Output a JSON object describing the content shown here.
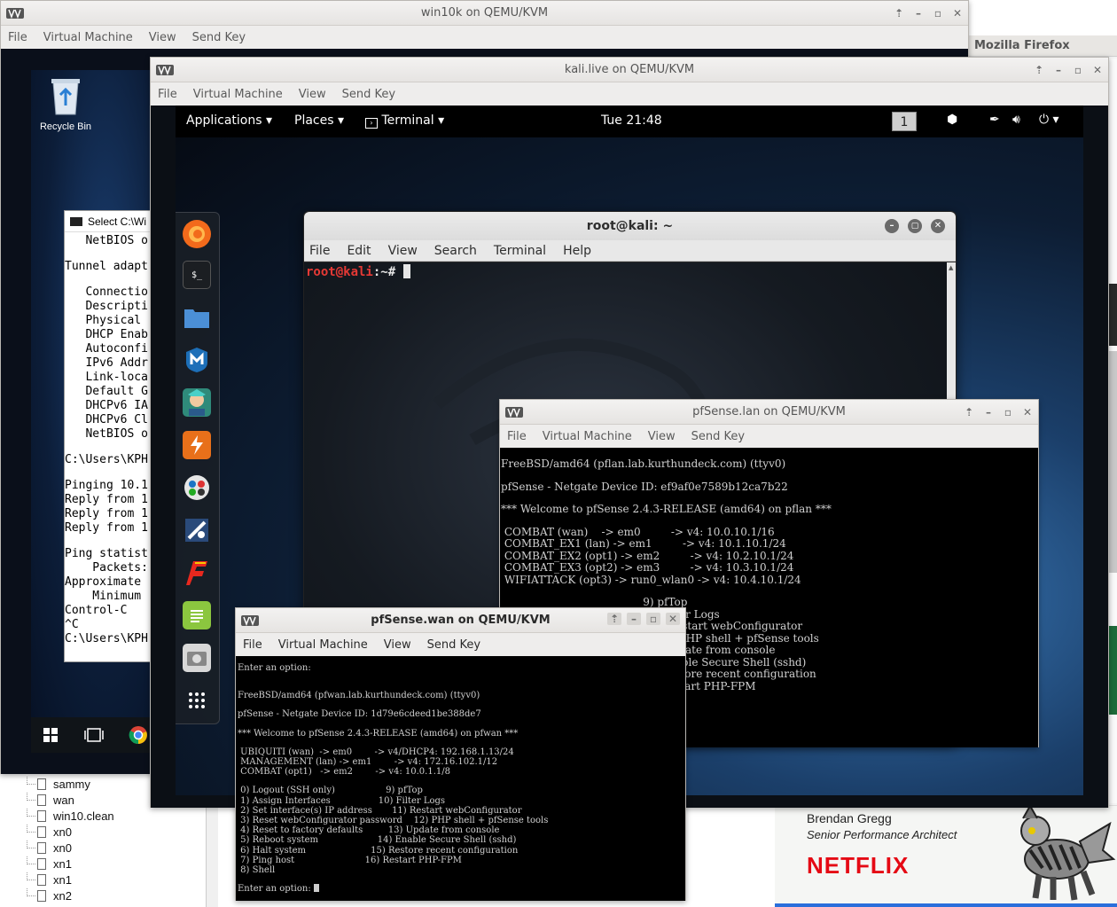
{
  "win10": {
    "title": "win10k on QEMU/KVM",
    "menu": [
      "File",
      "Virtual Machine",
      "View",
      "Send Key"
    ],
    "recycle_bin": "Recycle Bin",
    "cmd_title": "Select C:\\Wi",
    "cmd_lines": [
      "   NetBIOS o",
      "",
      "Tunnel adapt",
      "",
      "   Connectio",
      "   Descripti",
      "   Physical ",
      "   DHCP Enab",
      "   Autoconfi",
      "   IPv6 Addr",
      "   Link-loca",
      "   Default G",
      "   DHCPv6 IA",
      "   DHCPv6 Cl",
      "   NetBIOS o",
      "",
      "C:\\Users\\KPH",
      "",
      "Pinging 10.1",
      "Reply from 1",
      "Reply from 1",
      "Reply from 1",
      "",
      "Ping statist",
      "    Packets:",
      "Approximate ",
      "    Minimum ",
      "Control-C",
      "^C",
      "C:\\Users\\KPH"
    ]
  },
  "firefox": {
    "title": "Mozilla Firefox",
    "speaker_name": "Brendan Gregg",
    "speaker_title": "Senior Performance Architect",
    "brand": "NETFLIX",
    "netflix_color": "#e50914"
  },
  "tree": {
    "items": [
      "sammy",
      "wan",
      "win10.clean",
      "xn0",
      "xn0",
      "xn1",
      "xn1",
      "xn2"
    ]
  },
  "kali": {
    "title": "kali.live on QEMU/KVM",
    "menu": [
      "File",
      "Virtual Machine",
      "View",
      "Send Key"
    ],
    "panel": {
      "applications": "Applications",
      "places": "Places",
      "terminal": "Terminal",
      "clock": "Tue 21:48",
      "workspace": "1"
    },
    "terminal_window": {
      "title": "root@kali: ~",
      "menu": [
        "File",
        "Edit",
        "View",
        "Search",
        "Terminal",
        "Help"
      ],
      "prompt_user": "root@kali",
      "prompt_rest": ":~# "
    },
    "dock_icons": [
      "firefox-icon",
      "terminal-icon",
      "files-icon",
      "metasploit-icon",
      "armitage-icon",
      "burpsuite-icon",
      "maltego-icon",
      "beef-icon",
      "faraday-icon",
      "leafpad-icon",
      "screenshot-icon",
      "show-apps-icon"
    ]
  },
  "pflan": {
    "title": "pfSense.lan on QEMU/KVM",
    "menu": [
      "File",
      "Virtual Machine",
      "View",
      "Send Key"
    ],
    "lines": [
      "",
      "FreeBSD/amd64 (pflan.lab.kurthundeck.com) (ttyv0)",
      "",
      "pfSense - Netgate Device ID: ef9af0e7589b12ca7b22",
      "",
      "*** Welcome to pfSense 2.4.3-RELEASE (amd64) on pflan ***",
      "",
      " COMBAT (wan)    -> em0         -> v4: 10.0.10.1/16",
      " COMBAT_EX1 (lan) -> em1         -> v4: 10.1.10.1/24",
      " COMBAT_EX2 (opt1) -> em2         -> v4: 10.2.10.1/24",
      " COMBAT_EX3 (opt2) -> em3         -> v4: 10.3.10.1/24",
      " WIFIATTACK (opt3) -> run0_wlan0 -> v4: 10.4.10.1/24",
      "",
      "                                          9) pfTop",
      "                                         10) Filter Logs",
      "                            ess          11) Restart webConfigurator",
      "                            ssword       12) PHP shell + pfSense tools",
      "                            s            13) Update from console",
      "                                         14) Enable Secure Shell (sshd)",
      "                                         15) Restore recent configuration",
      "                                         16) Restart PHP-FPM"
    ]
  },
  "pfwan": {
    "title": "pfSense.wan on QEMU/KVM",
    "menu": [
      "File",
      "Virtual Machine",
      "View",
      "Send Key"
    ],
    "lines": [
      "Enter an option:",
      "",
      "",
      "FreeBSD/amd64 (pfwan.lab.kurthundeck.com) (ttyv0)",
      "",
      "pfSense - Netgate Device ID: 1d79e6cdeed1be388de7",
      "",
      "*** Welcome to pfSense 2.4.3-RELEASE (amd64) on pfwan ***",
      "",
      " UBIQUITI (wan)  -> em0        -> v4/DHCP4: 192.168.1.13/24",
      " MANAGEMENT (lan) -> em1        -> v4: 172.16.102.1/12",
      " COMBAT (opt1)   -> em2        -> v4: 10.0.1.1/8",
      "",
      " 0) Logout (SSH only)                  9) pfTop",
      " 1) Assign Interfaces                 10) Filter Logs",
      " 2) Set interface(s) IP address       11) Restart webConfigurator",
      " 3) Reset webConfigurator password    12) PHP shell + pfSense tools",
      " 4) Reset to factory defaults         13) Update from console",
      " 5) Reboot system                     14) Enable Secure Shell (sshd)",
      " 6) Halt system                       15) Restore recent configuration",
      " 7) Ping host                         16) Restart PHP-FPM",
      " 8) Shell",
      "",
      "Enter an option: "
    ]
  }
}
